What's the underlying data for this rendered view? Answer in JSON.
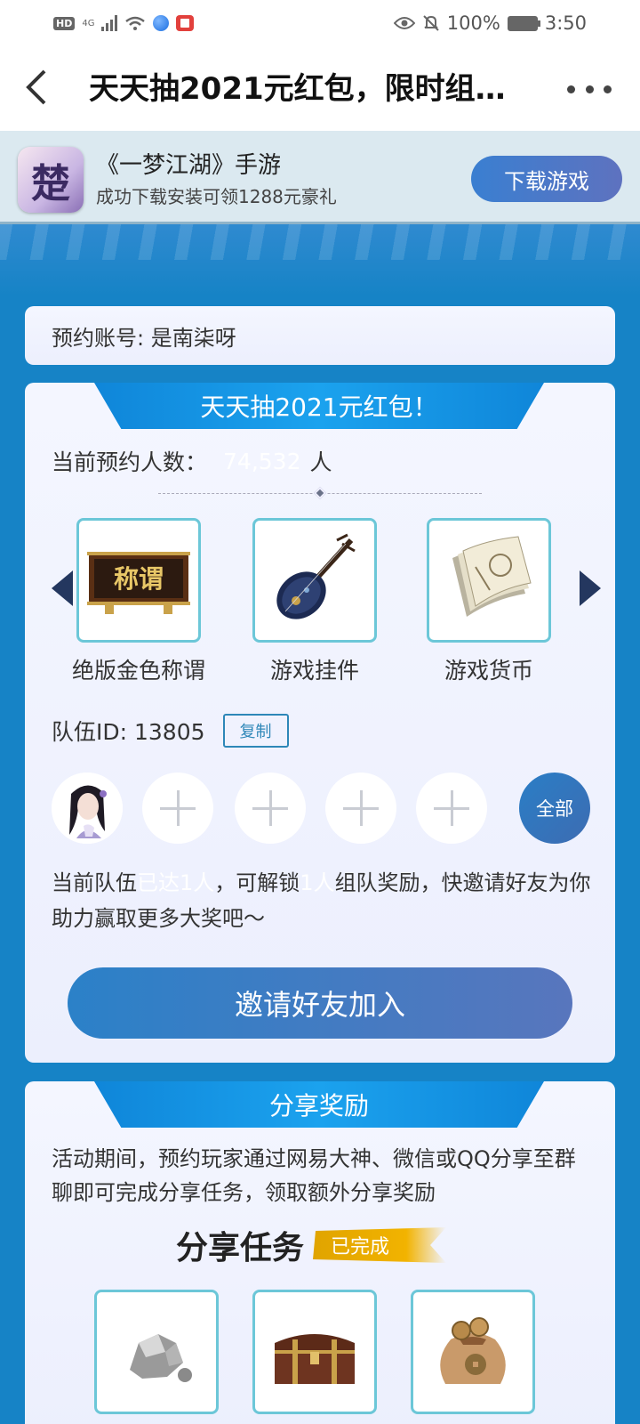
{
  "status_bar": {
    "hd": "HD",
    "network": "4G",
    "battery_percent": "100%",
    "time": "3:50"
  },
  "header": {
    "title": "天天抽2021元红包，限时组…",
    "back_icon": "chevron-left-icon",
    "more_icon": "more-dots-icon"
  },
  "game_banner": {
    "icon_text": "楚",
    "name": "《一梦江湖》手游",
    "subtitle": "成功下载安装可领1288元豪礼",
    "download_label": "下载游戏",
    "button_color": "#4a7ac9"
  },
  "account": {
    "label": "预约账号: 是南柒呀"
  },
  "raffle": {
    "ribbon_title": "天天抽2021元红包！",
    "count_label": "当前预约人数：",
    "count_value": "74,532",
    "count_unit": "人",
    "prizes": [
      {
        "label": "绝版金色称谓",
        "icon": "title-plaque-icon",
        "plaque_text": "称谓"
      },
      {
        "label": "游戏挂件",
        "icon": "pipa-instrument-icon"
      },
      {
        "label": "游戏货币",
        "icon": "paper-currency-icon"
      }
    ],
    "team_id_label": "队伍ID: 13805",
    "copy_label": "复制",
    "all_label": "全部",
    "desc_pre": "当前队伍",
    "desc_hidden1": "已达1人",
    "desc_mid": "，可解锁",
    "desc_hidden2": "1人",
    "desc_post": "组队奖励，快邀请好友为你助力赢取更多大奖吧～",
    "invite_label": "邀请好友加入"
  },
  "share": {
    "ribbon_title": "分享奖励",
    "desc": "活动期间，预约玩家通过网易大神、微信或QQ分享至群聊即可完成分享任务，领取额外分享奖励",
    "task_title": "分享任务",
    "done_label": "已完成",
    "prizes": [
      "stone-icon",
      "treasure-chest-icon",
      "money-bag-icon"
    ]
  },
  "colors": {
    "page_bg": "#1683c6",
    "ribbon": "#1ba2ee",
    "accent_done": "#f2b300"
  }
}
